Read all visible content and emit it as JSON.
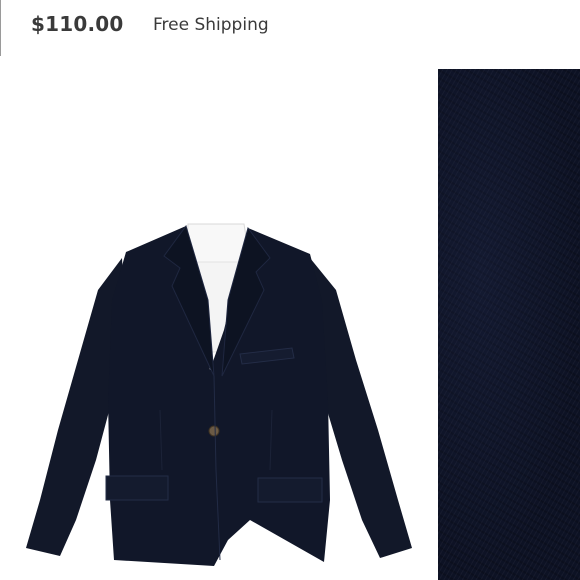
{
  "listing": {
    "price": "$110.00",
    "shipping": "Free Shipping"
  },
  "colors": {
    "jacket": "#111729",
    "shirt": "#f7f7f7",
    "button": "#6b5a45",
    "text": "#3a3a3a"
  },
  "icons": {
    "photo": "product-photo",
    "swatch": "fabric-swatch"
  }
}
